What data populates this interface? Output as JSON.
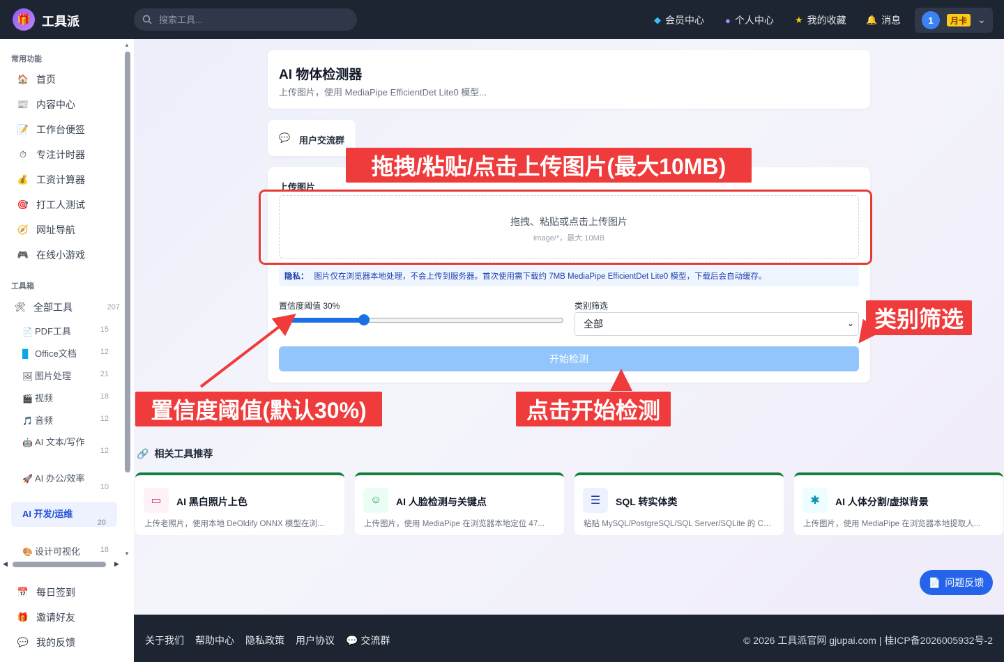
{
  "app": {
    "title": "工具派",
    "logo_icon": "gift-icon"
  },
  "search": {
    "placeholder": "搜索工具..."
  },
  "topnav": {
    "items": [
      {
        "label": "会员中心",
        "icon": "diamond-icon"
      },
      {
        "label": "个人中心",
        "icon": "person-icon"
      },
      {
        "label": "我的收藏",
        "icon": "star-icon"
      },
      {
        "label": "消息",
        "icon": "bell-icon"
      }
    ],
    "user": {
      "avatar": "1",
      "badge": "月卡"
    }
  },
  "sidebar": {
    "common_title": "常用功能",
    "common": [
      {
        "label": "首页",
        "icon": "home-icon"
      },
      {
        "label": "内容中心",
        "icon": "newspaper-icon"
      },
      {
        "label": "工作台便签",
        "icon": "memo-icon"
      },
      {
        "label": "专注计时器",
        "icon": "timer-icon"
      },
      {
        "label": "工资计算器",
        "icon": "money-bag-icon"
      },
      {
        "label": "打工人测试",
        "icon": "target-icon"
      },
      {
        "label": "网址导航",
        "icon": "compass-icon"
      },
      {
        "label": "在线小游戏",
        "icon": "gamepad-icon"
      }
    ],
    "toolbox_title": "工具箱",
    "all_tools": {
      "label": "全部工具",
      "count": "207"
    },
    "categories": [
      {
        "label": "PDF工具",
        "count": "15"
      },
      {
        "label": "Office文档",
        "count": "12"
      },
      {
        "label": "图片处理",
        "count": "21"
      },
      {
        "label": "视频",
        "count": "18"
      },
      {
        "label": "音频",
        "count": "12"
      },
      {
        "label": "AI 文本/写作",
        "count": "12"
      },
      {
        "label": "AI 办公/效率",
        "count": "10"
      },
      {
        "label": "AI 开发/运维",
        "count": "20"
      },
      {
        "label": "设计可视化",
        "count": "18"
      }
    ],
    "bottom": [
      {
        "label": "每日签到",
        "icon": "calendar-icon"
      },
      {
        "label": "邀请好友",
        "icon": "gift-icon"
      },
      {
        "label": "我的反馈",
        "icon": "speech-bubble-icon"
      }
    ]
  },
  "tool": {
    "title": "AI 物体检测器",
    "subtitle": "上传图片，使用 MediaPipe EfficientDet Lite0 模型...",
    "group_label": "用户交流群",
    "upload_label": "上传图片",
    "dropzone_main": "拖拽、粘贴或点击上传图片",
    "dropzone_sub": "image/*，最大 10MB",
    "privacy_title": "隐私：",
    "privacy_text": "图片仅在浏览器本地处理，不会上传到服务器。首次使用需下载约 7MB MediaPipe EfficientDet Lite0 模型，下载后会自动缓存。",
    "confidence_label": "置信度阈值 30%",
    "confidence_value": 0.3,
    "category_label": "类别筛选",
    "category_value": "全部",
    "start_label": "开始检测"
  },
  "annotations": {
    "upload": "拖拽/粘贴/点击上传图片(最大10MB)",
    "category": "类别筛选",
    "confidence": "置信度阈值(默认30%)",
    "start": "点击开始检测"
  },
  "related": {
    "title": "相关工具推荐",
    "items": [
      {
        "name": "AI 黑白照片上色",
        "desc": "上传老照片，使用本地 DeOldify ONNX 模型在浏...",
        "icon": "image-icon"
      },
      {
        "name": "AI 人脸检测与关键点",
        "desc": "上传图片，使用 MediaPipe 在浏览器本地定位 47...",
        "icon": "smiley-icon"
      },
      {
        "name": "SQL 转实体类",
        "desc": "粘贴 MySQL/PostgreSQL/SQL Server/SQLite 的 CR...",
        "icon": "database-icon"
      },
      {
        "name": "AI 人体分割/虚拟背景",
        "desc": "上传图片，使用 MediaPipe 在浏览器本地提取人...",
        "icon": "person-figure-icon"
      }
    ]
  },
  "feedback": {
    "label": "问题反馈"
  },
  "footer": {
    "links": [
      "关于我们",
      "帮助中心",
      "隐私政策",
      "用户协议",
      "交流群"
    ],
    "copyright": "© 2026 工具派官网 gjupai.com | 桂ICP备2026005932号-2"
  }
}
